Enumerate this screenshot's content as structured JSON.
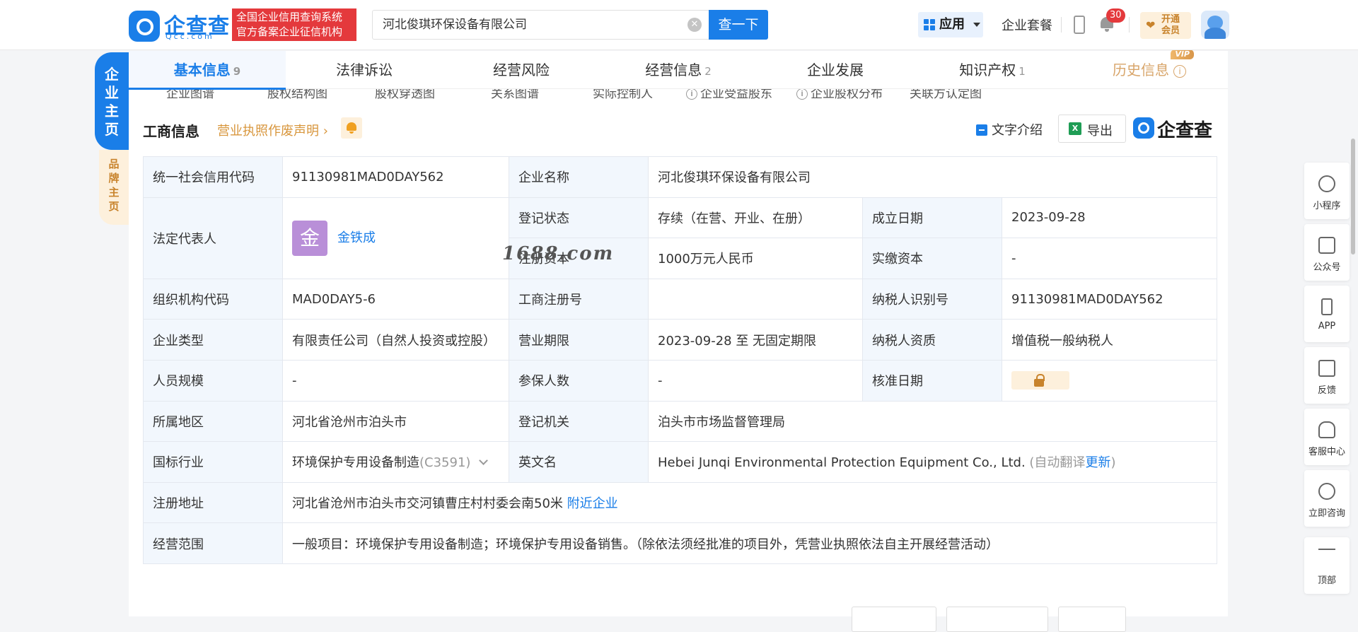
{
  "header": {
    "logo_name": "企查查",
    "logo_url": "Qcc.com",
    "badge_line1": "全国企业信用查询系统",
    "badge_line2": "官方备案企业征信机构",
    "search_value": "河北俊琪环保设备有限公司",
    "search_button": "查一下",
    "app_label": "应用",
    "suite_label": "企业套餐",
    "notification_count": "30",
    "vip_line1": "开通",
    "vip_line2": "会员"
  },
  "sidetabs": {
    "main": [
      "企",
      "业",
      "主",
      "页"
    ],
    "brand": [
      "品",
      "牌",
      "主",
      "页"
    ]
  },
  "tabs": [
    {
      "label": "基本信息",
      "count": "9"
    },
    {
      "label": "法律诉讼",
      "count": ""
    },
    {
      "label": "经营风险",
      "count": ""
    },
    {
      "label": "经营信息",
      "count": "2"
    },
    {
      "label": "企业发展",
      "count": ""
    },
    {
      "label": "知识产权",
      "count": "1"
    },
    {
      "label": "历史信息",
      "count": ""
    }
  ],
  "history_tag": "VIP",
  "subnav": [
    "企业图谱",
    "股权结构图",
    "股权穿透图",
    "关系图谱",
    "实际控制人",
    "企业受益股东",
    "企业股权分布",
    "关联方认定图"
  ],
  "section": {
    "title": "工商信息",
    "license_link": "营业执照作废声明",
    "text_intro": "文字介绍",
    "export": "导出",
    "watermark_logo": "企查查"
  },
  "table": {
    "credit_code_label": "统一社会信用代码",
    "credit_code": "91130981MAD0DAY562",
    "company_name_label": "企业名称",
    "company_name": "河北俊琪环保设备有限公司",
    "legal_rep_label": "法定代表人",
    "legal_rep_avatar": "金",
    "legal_rep": "金铁成",
    "reg_status_label": "登记状态",
    "reg_status": "存续（在营、开业、在册）",
    "founded_label": "成立日期",
    "founded": "2023-09-28",
    "reg_capital_label": "注册资本",
    "reg_capital": "1000万元人民币",
    "paid_capital_label": "实缴资本",
    "paid_capital": "-",
    "org_code_label": "组织机构代码",
    "org_code": "MAD0DAY5-6",
    "biz_reg_no_label": "工商注册号",
    "biz_reg_no": "",
    "taxpayer_id_label": "纳税人识别号",
    "taxpayer_id": "91130981MAD0DAY562",
    "company_type_label": "企业类型",
    "company_type": "有限责任公司（自然人投资或控股）",
    "term_label": "营业期限",
    "term": "2023-09-28 至 无固定期限",
    "taxpayer_qual_label": "纳税人资质",
    "taxpayer_qual": "增值税一般纳税人",
    "staff_label": "人员规模",
    "staff": "-",
    "insured_label": "参保人数",
    "insured": "-",
    "approval_label": "核准日期",
    "region_label": "所属地区",
    "region": "河北省沧州市泊头市",
    "authority_label": "登记机关",
    "authority": "泊头市市场监督管理局",
    "industry_label": "国标行业",
    "industry": "环境保护专用设备制造",
    "industry_code": "(C3591)",
    "english_label": "英文名",
    "english_name": "Hebei Junqi Environmental Protection Equipment Co., Ltd.",
    "auto_translate": "(自动翻译",
    "update_link": "更新",
    "close_paren": ")",
    "address_label": "注册地址",
    "address": "河北省沧州市泊头市交河镇曹庄村村委会南50米",
    "nearby_link": "附近企业",
    "scope_label": "经营范围",
    "scope": "一般项目：环境保护专用设备制造；环境保护专用设备销售。（除依法须经批准的项目外，凭营业执照依法自主开展经营活动）"
  },
  "watermark": "1688.com",
  "rightbar": [
    "小程序",
    "公众号",
    "APP",
    "反馈",
    "客服中心",
    "立即咨询",
    "顶部"
  ]
}
